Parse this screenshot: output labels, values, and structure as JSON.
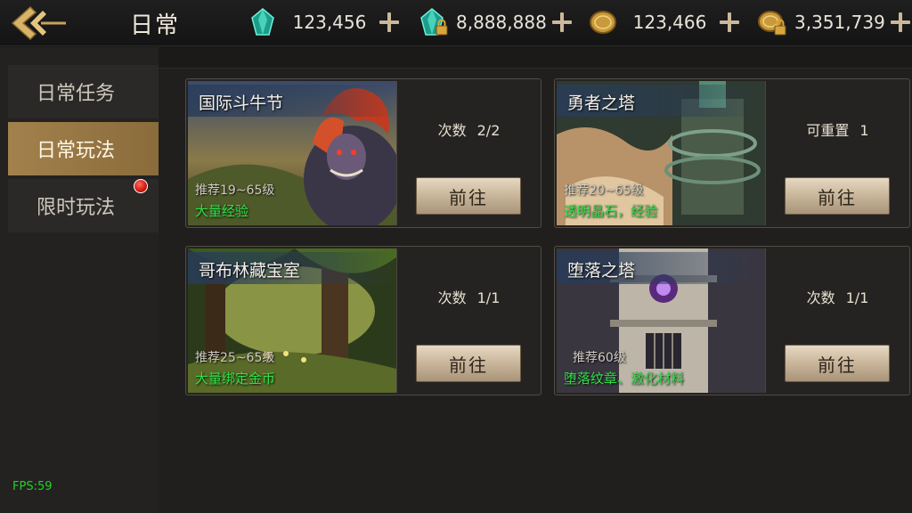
{
  "header": {
    "title": "日常",
    "back_icon": "back-arrow-icon",
    "currencies": [
      {
        "icon": "green-crystal-icon",
        "value": "123,456",
        "locked": false
      },
      {
        "icon": "locked-green-crystal-icon",
        "value": "8,888,888",
        "locked": true
      },
      {
        "icon": "gold-coin-icon",
        "value": "123,466",
        "locked": false
      },
      {
        "icon": "locked-gold-coin-icon",
        "value": "3,351,739",
        "locked": true
      }
    ]
  },
  "sidebar": {
    "items": [
      {
        "label": "日常任务",
        "active": false,
        "badge": false
      },
      {
        "label": "日常玩法",
        "active": true,
        "badge": false
      },
      {
        "label": "限时玩法",
        "active": false,
        "badge": true
      }
    ]
  },
  "cards": [
    {
      "title": "国际斗牛节",
      "recommend": "推荐19~65级",
      "reward": "大量经验",
      "count_label": "次数",
      "count_value": "2/2",
      "button": "前往"
    },
    {
      "title": "勇者之塔",
      "recommend": "推荐20~65级",
      "reward": "透明晶石，经验",
      "count_label": "可重置",
      "count_value": "1",
      "button": "前往"
    },
    {
      "title": "哥布林藏宝室",
      "recommend": "推荐25~65级",
      "reward": "大量绑定金币",
      "count_label": "次数",
      "count_value": "1/1",
      "button": "前往"
    },
    {
      "title": "堕落之塔",
      "recommend": "推荐60级",
      "reward": "堕落纹章、激化材料",
      "count_label": "次数",
      "count_value": "1/1",
      "button": "前往"
    }
  ],
  "debug": {
    "fps": "FPS:59"
  },
  "colors": {
    "accent_gold": "#a2814c",
    "reward_green": "#31e048",
    "badge_red": "#d3140c"
  }
}
